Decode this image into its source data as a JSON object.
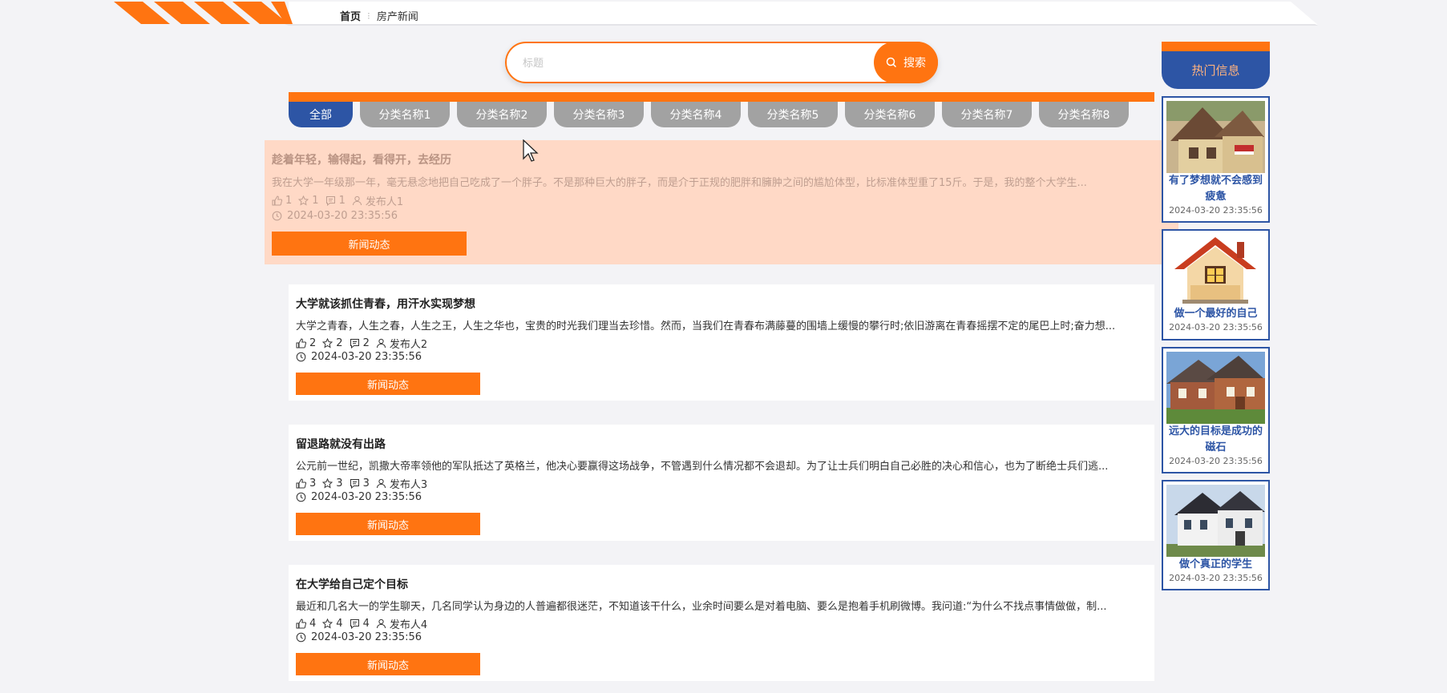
{
  "breadcrumb": {
    "home": "首页",
    "separator": "⁝",
    "current": "房产新闻"
  },
  "search": {
    "placeholder": "标题",
    "button_label": "搜索"
  },
  "categories": [
    "全部",
    "分类名称1",
    "分类名称2",
    "分类名称3",
    "分类名称4",
    "分类名称5",
    "分类名称6",
    "分类名称7",
    "分类名称8"
  ],
  "news": [
    {
      "title": "趁着年轻，输得起，看得开，去经历",
      "summary": "我在大学一年级那一年，毫无悬念地把自己吃成了一个胖子。不是那种巨大的胖子，而是介于正规的肥胖和臃肿之间的尴尬体型，比标准体型重了15斤。于是，我的整个大学生...",
      "likes": "1",
      "favorites": "1",
      "comments": "1",
      "publisher": "发布人1",
      "time": "2024-03-20 23:35:56",
      "button": "新闻动态"
    },
    {
      "title": "大学就该抓住青春，用汗水实现梦想",
      "summary": "大学之青春，人生之春，人生之王，人生之华也，宝贵的时光我们理当去珍惜。然而，当我们在青春布满藤蔓的围墙上缓慢的攀行时;依旧游离在青春摇摆不定的尾巴上时;奋力想...",
      "likes": "2",
      "favorites": "2",
      "comments": "2",
      "publisher": "发布人2",
      "time": "2024-03-20 23:35:56",
      "button": "新闻动态"
    },
    {
      "title": "留退路就没有出路",
      "summary": "公元前一世纪，凯撒大帝率领他的军队抵达了英格兰，他决心要赢得这场战争，不管遇到什么情况都不会退却。为了让士兵们明白自己必胜的决心和信心，也为了断绝士兵们逃...",
      "likes": "3",
      "favorites": "3",
      "comments": "3",
      "publisher": "发布人3",
      "time": "2024-03-20 23:35:56",
      "button": "新闻动态"
    },
    {
      "title": "在大学给自己定个目标",
      "summary": "最近和几名大一的学生聊天，几名同学认为身边的人普遍都很迷茫，不知道该干什么，业余时间要么是对着电脑、要么是抱着手机刷微博。我问道:“为什么不找点事情做做，制...",
      "likes": "4",
      "favorites": "4",
      "comments": "4",
      "publisher": "发布人4",
      "time": "2024-03-20 23:35:56",
      "button": "新闻动态"
    }
  ],
  "hot": {
    "heading": "热门信息",
    "items": [
      {
        "title": "有了梦想就不会感到疲惫",
        "time": "2024-03-20 23:35:56",
        "image": "cottage-house"
      },
      {
        "title": "做一个最好的自己",
        "time": "2024-03-20 23:35:56",
        "image": "house-icon"
      },
      {
        "title": "远大的目标是成功的磁石",
        "time": "2024-03-20 23:35:56",
        "image": "brick-house"
      },
      {
        "title": "做个真正的学生",
        "time": "2024-03-20 23:35:56",
        "image": "white-villa"
      }
    ]
  },
  "colors": {
    "accent": "#ff7411",
    "primary": "#2d55a5",
    "tab_inactive": "#a2a2a2",
    "hover_bg": "#ffd9c6"
  }
}
